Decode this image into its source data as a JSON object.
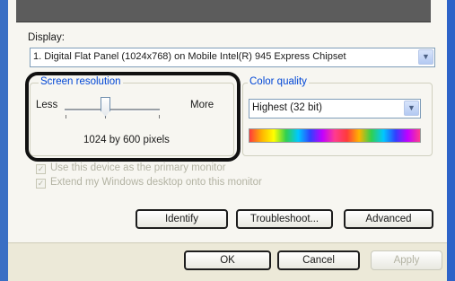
{
  "display": {
    "label": "Display:",
    "value": "1. Digital Flat Panel (1024x768) on Mobile Intel(R) 945 Express Chipset"
  },
  "screen_resolution": {
    "title": "Screen resolution",
    "less": "Less",
    "more": "More",
    "value_text": "1024 by 600 pixels"
  },
  "color_quality": {
    "title": "Color quality",
    "value": "Highest (32 bit)"
  },
  "options": {
    "primary": "Use this device as the primary monitor",
    "extend": "Extend my Windows desktop onto this monitor"
  },
  "buttons": {
    "identify": "Identify",
    "troubleshoot": "Troubleshoot...",
    "advanced": "Advanced",
    "ok": "OK",
    "cancel": "Cancel",
    "apply": "Apply"
  },
  "colors": {
    "group_title": "#0046d5",
    "window_blue": "#3a6fc4",
    "dialog_bg": "#ece9d8"
  }
}
